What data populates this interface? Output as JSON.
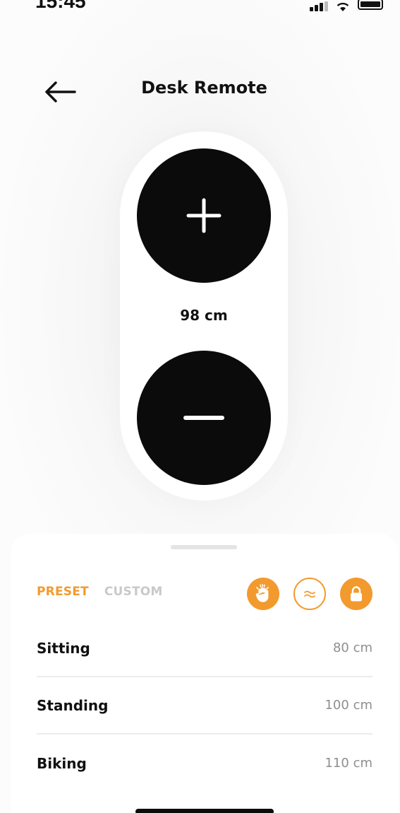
{
  "status_bar": {
    "time": "15:45",
    "icons": [
      "signal-icon",
      "wifi-icon",
      "battery-icon"
    ]
  },
  "header": {
    "title": "Desk Remote",
    "back_icon": "arrow-left-icon"
  },
  "remote": {
    "up_icon": "plus-icon",
    "down_icon": "minus-icon",
    "height_value": "98 cm"
  },
  "sheet": {
    "tabs": [
      {
        "label": "PRESET",
        "active": true
      },
      {
        "label": "CUSTOM",
        "active": false
      }
    ],
    "mode_icons": [
      "hand-wave-icon",
      "waves-icon",
      "lock-icon"
    ],
    "presets": [
      {
        "name": "Sitting",
        "value": "80 cm"
      },
      {
        "name": "Standing",
        "value": "100 cm"
      },
      {
        "name": "Biking",
        "value": "110 cm"
      }
    ]
  },
  "colors": {
    "accent": "#f29a2e",
    "button": "#0b0b0b",
    "muted_text": "#8e8e8e",
    "inactive_tab": "#c9c9c9"
  }
}
